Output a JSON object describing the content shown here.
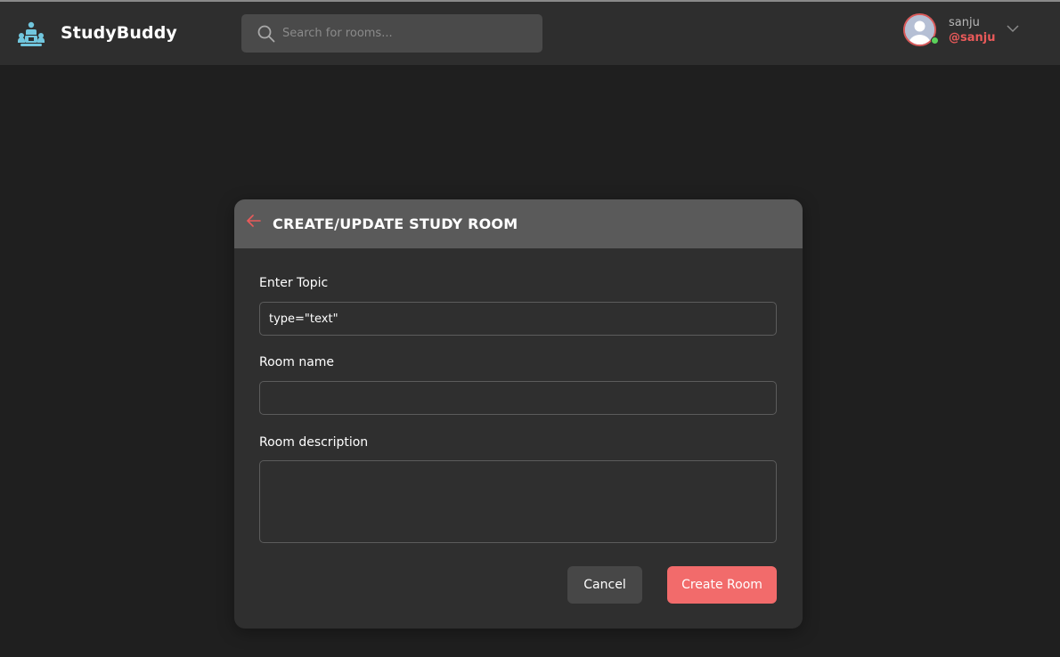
{
  "app": {
    "brand": "StudyBuddy",
    "logo_icon": "study-group-icon",
    "accent": "#71c6dd"
  },
  "search": {
    "placeholder": "Search for rooms...",
    "value": ""
  },
  "user": {
    "name": "sanju",
    "handle": "@sanju",
    "status": "online"
  },
  "modal": {
    "title": "CREATE/UPDATE STUDY ROOM",
    "fields": {
      "topic": {
        "label": "Enter Topic",
        "value": "type=\"text\""
      },
      "room_name": {
        "label": "Room name",
        "value": ""
      },
      "room_description": {
        "label": "Room description",
        "value": ""
      }
    },
    "buttons": {
      "cancel": "Cancel",
      "create": "Create Room"
    }
  },
  "colors": {
    "primary": "#f26b6b",
    "background": "#1f1f1f",
    "header": "#2e2e2e"
  }
}
